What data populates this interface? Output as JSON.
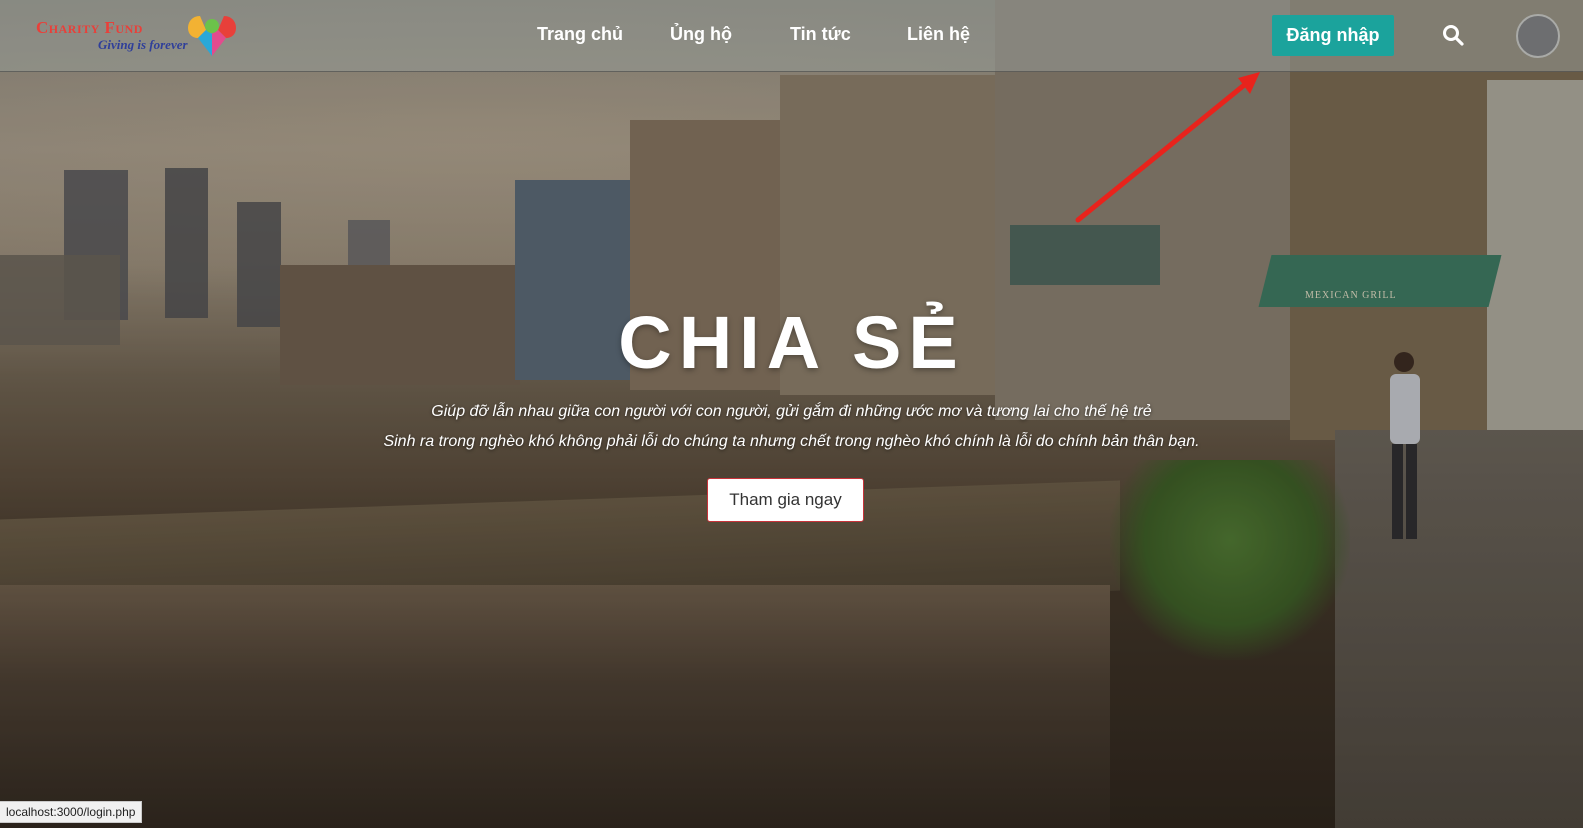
{
  "brand": {
    "name": "Charity Fund",
    "tagline": "Giving is forever"
  },
  "nav": {
    "items": [
      {
        "label": "Trang chủ"
      },
      {
        "label": "Ủng hộ"
      },
      {
        "label": "Tin tức"
      },
      {
        "label": "Liên hệ"
      }
    ],
    "login_label": "Đăng nhập"
  },
  "hero": {
    "title": "CHIA SẺ",
    "line1": "Giúp đỡ lẫn nhau giữa con người với con người, gửi gắm đi những ước mơ và tương lai cho thế hệ trẻ",
    "line2": "Sinh ra trong nghèo khó không phải lỗi do chúng ta nhưng chết trong nghèo khó chính là lỗi do chính bản thân bạn.",
    "cta_label": "Tham gia ngay",
    "scene_sign": "MEXICAN GRILL"
  },
  "status": {
    "url": "localhost:3000/login.php"
  },
  "colors": {
    "login_button": "#1ba39c",
    "cta_border": "#c8333a",
    "brand_red": "#e8403a",
    "brand_blue": "#2f3f9a",
    "annotation_arrow": "#e8231c"
  },
  "icons": {
    "search": "search-icon",
    "avatar": "user-avatar",
    "annotation": "arrow-annotation"
  }
}
